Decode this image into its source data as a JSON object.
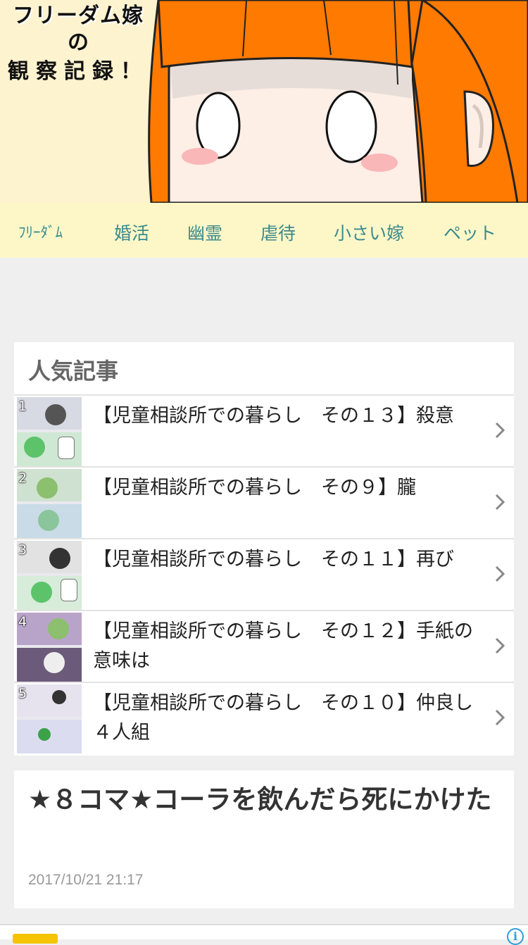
{
  "banner": {
    "title_line1": "フリーダム嫁",
    "title_line2": "の",
    "title_line3": "観察記録！"
  },
  "nav": {
    "items": [
      {
        "label": "ﾌﾘｰﾀﾞﾑ"
      },
      {
        "label": "婚活"
      },
      {
        "label": "幽霊"
      },
      {
        "label": "虐待"
      },
      {
        "label": "小さい嫁"
      },
      {
        "label": "ペット"
      }
    ]
  },
  "popular": {
    "title": "人気記事",
    "items": [
      {
        "rank": "1",
        "title": "【児童相談所での暮らし　その１３】殺意"
      },
      {
        "rank": "2",
        "title": "【児童相談所での暮らし　その９】朧"
      },
      {
        "rank": "3",
        "title": "【児童相談所での暮らし　その１１】再び"
      },
      {
        "rank": "4",
        "title": "【児童相談所での暮らし　その１２】手紙の意味は"
      },
      {
        "rank": "5",
        "title": "【児童相談所での暮らし　その１０】仲良し４人組"
      }
    ]
  },
  "article": {
    "title": "★８コマ★コーラを飲んだら死にかけた",
    "date": "2017/10/21 21:17"
  },
  "ad": {
    "info_icon": "i"
  },
  "colors": {
    "nav_bg": "#fdf7c8",
    "nav_text": "#3a8a8c",
    "hair": "#ff7a00",
    "page_bg": "#efefef"
  }
}
